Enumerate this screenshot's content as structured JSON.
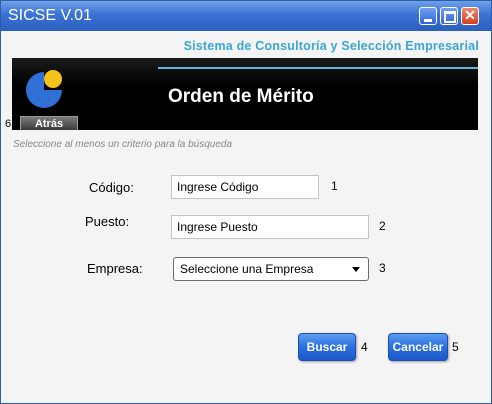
{
  "window": {
    "title": "SICSE V.01",
    "controls": {
      "minimize": "minimize-icon",
      "maximize": "maximize-icon",
      "close": "close-icon"
    }
  },
  "header": {
    "subtitle": "Sistema de Consultoría y Selección Empresarial",
    "banner_title": "Orden de Mérito",
    "back_label": "Atrás",
    "back_marker": "6"
  },
  "form": {
    "hint": "Seleccione al menos un criterio para la búsqueda",
    "codigo": {
      "label": "Código:",
      "value": "Ingrese Código",
      "marker": "1"
    },
    "puesto": {
      "label": "Puesto:",
      "value": "Ingrese Puesto",
      "marker": "2"
    },
    "empresa": {
      "label": "Empresa:",
      "selected": "Seleccione una Empresa",
      "marker": "3"
    }
  },
  "actions": {
    "buscar": {
      "label": "Buscar",
      "marker": "4"
    },
    "cancelar": {
      "label": "Cancelar",
      "marker": "5"
    }
  },
  "colors": {
    "titlebar": "#3a72d4",
    "subtitle": "#3aa6d8",
    "banner": "#000000",
    "button": "#2a6fe0",
    "logo_blue": "#2f6fd6",
    "logo_yellow": "#f4c21a"
  }
}
